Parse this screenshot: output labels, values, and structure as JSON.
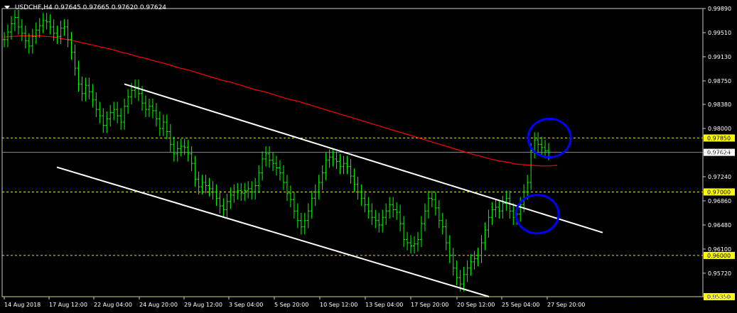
{
  "header": {
    "symbol_timeframe": "USDCHF,H4",
    "ohlc": "0.97645 0.97665 0.97620 0.97624"
  },
  "colors": {
    "background": "#000000",
    "grid_border": "#ffffff",
    "candles": "#00ff00",
    "ma": "#ff0000",
    "level_line": "#ffd700",
    "channel": "#ffffff",
    "highlight": "#0000ff",
    "price_badge": "#ffff00"
  },
  "chart_data": {
    "type": "line",
    "title": "USDCHF,H4",
    "ylim": [
      0.9535,
      0.9989
    ],
    "y_ticks": [
      "0.99890",
      "0.99510",
      "0.99130",
      "0.98750",
      "0.98380",
      "0.98000",
      "0.97620",
      "0.97240",
      "0.96860",
      "0.96480",
      "0.96100",
      "0.95720",
      "0.95350"
    ],
    "x_ticks": [
      "14 Aug 2018",
      "17 Aug 12:00",
      "22 Aug 04:00",
      "24 Aug 20:00",
      "29 Aug 12:00",
      "3 Sep 04:00",
      "5 Sep 20:00",
      "10 Sep 12:00",
      "13 Sep 04:00",
      "17 Sep 20:00",
      "20 Sep 12:00",
      "25 Sep 04:00",
      "27 Sep 20:00"
    ],
    "horizontal_levels": [
      {
        "value": 0.9785,
        "label": "0.97850"
      },
      {
        "value": 0.97,
        "label": "0.97000"
      },
      {
        "value": 0.96,
        "label": "0.96000"
      },
      {
        "value": 0.9535,
        "label": "0.95350"
      }
    ],
    "current_price": {
      "value": 0.97624,
      "label": "0.97624"
    },
    "series": [
      {
        "name": "",
        "kind": "close",
        "values": [
          0.994,
          0.9952,
          0.9965,
          0.9975,
          0.996,
          0.995,
          0.9938,
          0.993,
          0.9945,
          0.9955,
          0.9962,
          0.997,
          0.9968,
          0.996,
          0.995,
          0.9945,
          0.9958,
          0.996,
          0.994,
          0.992,
          0.9895,
          0.987,
          0.9855,
          0.9868,
          0.9858,
          0.9845,
          0.983,
          0.982,
          0.9805,
          0.9815,
          0.9825,
          0.983,
          0.982,
          0.981,
          0.9835,
          0.985,
          0.986,
          0.9865,
          0.9855,
          0.984,
          0.983,
          0.9835,
          0.9828,
          0.9815,
          0.98,
          0.981,
          0.9795,
          0.9775,
          0.976,
          0.9768,
          0.9772,
          0.977,
          0.976,
          0.9745,
          0.972,
          0.9708,
          0.9715,
          0.971,
          0.9705,
          0.97,
          0.969,
          0.9678,
          0.9672,
          0.9685,
          0.9695,
          0.97,
          0.9702,
          0.9698,
          0.9702,
          0.9705,
          0.97,
          0.971,
          0.973,
          0.9752,
          0.976,
          0.975,
          0.9745,
          0.9738,
          0.973,
          0.9715,
          0.9698,
          0.9688,
          0.967,
          0.9655,
          0.9645,
          0.9655,
          0.967,
          0.969,
          0.97,
          0.9715,
          0.973,
          0.975,
          0.9755,
          0.9752,
          0.9748,
          0.974,
          0.9745,
          0.974,
          0.9725,
          0.9712,
          0.97,
          0.969,
          0.968,
          0.967,
          0.966,
          0.9655,
          0.9648,
          0.966,
          0.967,
          0.968,
          0.9672,
          0.9668,
          0.965,
          0.9625,
          0.962,
          0.9615,
          0.9618,
          0.9625,
          0.965,
          0.967,
          0.969,
          0.9688,
          0.9675,
          0.9655,
          0.9645,
          0.962,
          0.96,
          0.958,
          0.9565,
          0.9555,
          0.957,
          0.958,
          0.959,
          0.9595,
          0.96,
          0.962,
          0.964,
          0.966,
          0.9672,
          0.9676,
          0.967,
          0.9682,
          0.969,
          0.967,
          0.966,
          0.9665,
          0.968,
          0.97,
          0.9715,
          0.9765,
          0.9782,
          0.9775,
          0.977,
          0.9765,
          0.9762
        ]
      },
      {
        "name": "",
        "kind": "moving_average",
        "values": [
          0.9944,
          0.9945,
          0.9946,
          0.9946,
          0.9946,
          0.9945,
          0.9944,
          0.9941,
          0.9939,
          0.9936,
          0.9933,
          0.993,
          0.9927,
          0.9924,
          0.992,
          0.9917,
          0.9913,
          0.991,
          0.9906,
          0.9903,
          0.9899,
          0.9895,
          0.9892,
          0.9888,
          0.9884,
          0.988,
          0.9876,
          0.9873,
          0.9869,
          0.9865,
          0.9861,
          0.9858,
          0.9854,
          0.985,
          0.9846,
          0.9843,
          0.9839,
          0.9835,
          0.9831,
          0.9827,
          0.9823,
          0.9819,
          0.9815,
          0.9811,
          0.9807,
          0.9803,
          0.9799,
          0.9795,
          0.9791,
          0.9787,
          0.9783,
          0.9779,
          0.9775,
          0.9771,
          0.9767,
          0.9763,
          0.9759,
          0.9756,
          0.9752,
          0.9749,
          0.9747,
          0.9744,
          0.9743,
          0.9742,
          0.9741,
          0.9741,
          0.9742
        ]
      }
    ],
    "annotations": [
      {
        "type": "trendline",
        "from": {
          "x": "22 Aug 04:00",
          "y": 0.987
        },
        "to": {
          "x": "27 Sep 20:00",
          "y": 0.9636
        }
      },
      {
        "type": "trendline",
        "from": {
          "x": "14 Aug 2018",
          "y": 0.9739
        },
        "to": {
          "x": "20 Sep 12:00",
          "y": 0.9535
        }
      },
      {
        "type": "circle",
        "at": {
          "x": "27 Sep 20:00",
          "y": 0.9785
        }
      },
      {
        "type": "circle",
        "at": {
          "x": "25 Sep 04:00",
          "y": 0.9665
        }
      }
    ],
    "legend": "none",
    "grid": false
  }
}
